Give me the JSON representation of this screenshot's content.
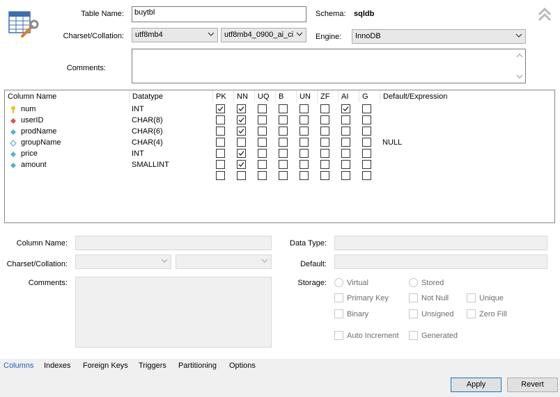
{
  "header": {
    "table_name_label": "Table Name:",
    "table_name_value": "buytbl",
    "schema_label": "Schema:",
    "schema_value": "sqldb",
    "charset_label": "Charset/Collation:",
    "charset_value": "utf8mb4",
    "collation_value": "utf8mb4_0900_ai_ci",
    "engine_label": "Engine:",
    "engine_value": "InnoDB",
    "comments_label": "Comments:"
  },
  "columns_grid": {
    "headers": [
      "Column Name",
      "Datatype",
      "PK",
      "NN",
      "UQ",
      "B",
      "UN",
      "ZF",
      "AI",
      "G",
      "Default/Expression"
    ],
    "rows": [
      {
        "name": "num",
        "icon": "key-icon",
        "type": "INT",
        "flags": [
          1,
          1,
          0,
          0,
          0,
          0,
          1,
          0
        ],
        "default": ""
      },
      {
        "name": "userID",
        "icon": "foreign-key-icon",
        "type": "CHAR(8)",
        "flags": [
          0,
          1,
          0,
          0,
          0,
          0,
          0,
          0
        ],
        "default": ""
      },
      {
        "name": "prodName",
        "icon": "column-nn-icon",
        "type": "CHAR(6)",
        "flags": [
          0,
          1,
          0,
          0,
          0,
          0,
          0,
          0
        ],
        "default": ""
      },
      {
        "name": "groupName",
        "icon": "column-icon",
        "type": "CHAR(4)",
        "flags": [
          0,
          0,
          0,
          0,
          0,
          0,
          0,
          0
        ],
        "default": "NULL"
      },
      {
        "name": "price",
        "icon": "column-nn-icon",
        "type": "INT",
        "flags": [
          0,
          1,
          0,
          0,
          0,
          0,
          0,
          0
        ],
        "default": ""
      },
      {
        "name": "amount",
        "icon": "column-nn-icon",
        "type": "SMALLINT",
        "flags": [
          0,
          1,
          0,
          0,
          0,
          0,
          0,
          0
        ],
        "default": ""
      },
      {
        "name": "",
        "icon": "",
        "type": "",
        "flags": [
          0,
          0,
          0,
          0,
          0,
          0,
          0,
          0
        ],
        "default": ""
      }
    ]
  },
  "details": {
    "column_name_label": "Column Name:",
    "charset_label": "Charset/Collation:",
    "comments_label": "Comments:",
    "data_type_label": "Data Type:",
    "default_label": "Default:",
    "storage_label": "Storage:",
    "virtual": "Virtual",
    "stored": "Stored",
    "primary_key": "Primary Key",
    "not_null": "Not Null",
    "unique": "Unique",
    "binary": "Binary",
    "unsigned": "Unsigned",
    "zero_fill": "Zero Fill",
    "auto_increment": "Auto Increment",
    "generated": "Generated"
  },
  "tabs": [
    "Columns",
    "Indexes",
    "Foreign Keys",
    "Triggers",
    "Partitioning",
    "Options"
  ],
  "buttons": {
    "apply": "Apply",
    "revert": "Revert"
  },
  "colors": {
    "active_tab": "#1b62b8",
    "key": "#f2c21b",
    "fk": "#d9534f",
    "column": "#4fb6c9"
  }
}
